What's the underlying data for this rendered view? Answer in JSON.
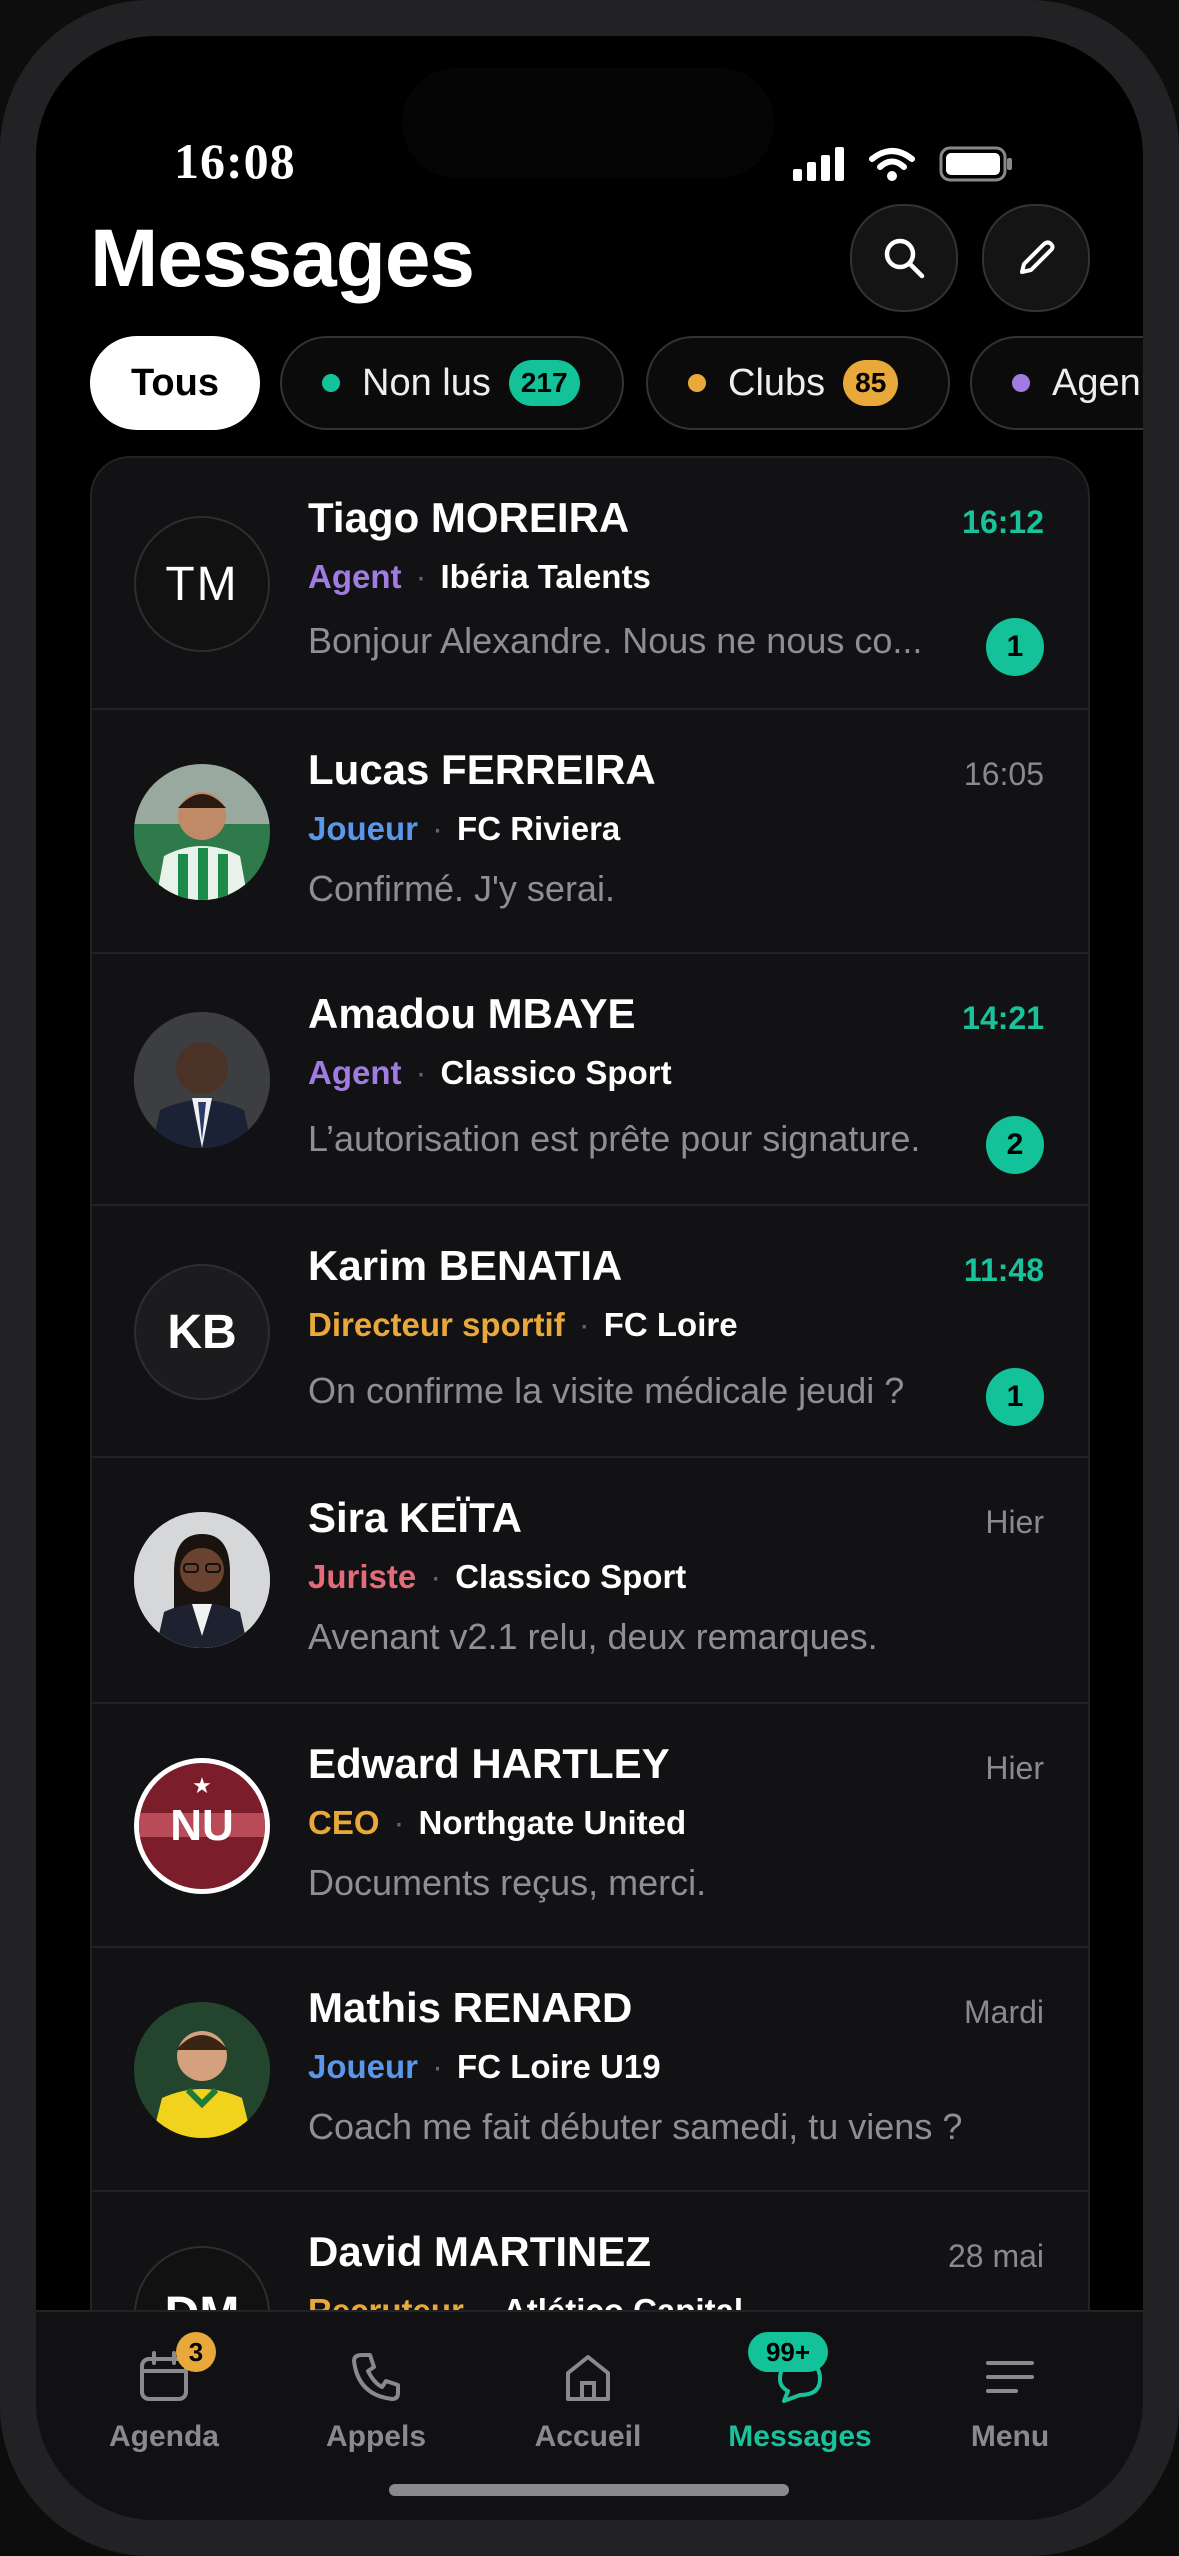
{
  "status": {
    "time": "16:08"
  },
  "header": {
    "title": "Messages"
  },
  "filters": [
    {
      "label": "Tous",
      "active": true
    },
    {
      "label": "Non lus",
      "count": "217",
      "color": "#14c29a"
    },
    {
      "label": "Clubs",
      "count": "85",
      "color": "#e8a93a"
    },
    {
      "label": "Agen",
      "color": "#a07be0"
    }
  ],
  "conversations": [
    {
      "name": "Tiago MOREIRA",
      "initials": "TM",
      "role": "Agent",
      "role_color": "#a07be0",
      "org": "Ibéria Talents",
      "preview": "Bonjour Alexandre. Nous ne nous co...",
      "time": "16:12",
      "unread": "1"
    },
    {
      "name": "Lucas FERREIRA",
      "avatar": "photo-green-jersey",
      "role": "Joueur",
      "role_color": "#5a97ea",
      "org": "FC Riviera",
      "preview": "Confirmé. J'y serai.",
      "time": "16:05"
    },
    {
      "name": "Amadou MBAYE",
      "avatar": "photo-suit",
      "role": "Agent",
      "role_color": "#a07be0",
      "org": "Classico Sport",
      "preview": "L’autorisation est prête pour signature.",
      "time": "14:21",
      "unread": "2"
    },
    {
      "name": "Karim BENATIA",
      "initials": "KB",
      "role": "Directeur sportif",
      "role_color": "#e8a93a",
      "org": "FC Loire",
      "preview": "On confirme la visite médicale jeudi ?",
      "time": "11:48",
      "unread": "1"
    },
    {
      "name": "Sira KEÏTA",
      "avatar": "photo-woman",
      "role": "Juriste",
      "role_color": "#e56b7a",
      "org": "Classico Sport",
      "preview": "Avenant v2.1 relu, deux remarques.",
      "time": "Hier"
    },
    {
      "name": "Edward HARTLEY",
      "initials": "NU",
      "avatar": "club-crest",
      "role": "CEO",
      "role_color": "#e8a93a",
      "org": "Northgate United",
      "preview": "Documents reçus, merci.",
      "time": "Hier"
    },
    {
      "name": "Mathis RENARD",
      "avatar": "photo-yellow-jersey",
      "role": "Joueur",
      "role_color": "#5a97ea",
      "org": "FC Loire U19",
      "preview": "Coach me fait débuter samedi, tu viens ?",
      "time": "Mardi"
    },
    {
      "name": "David MARTINEZ",
      "initials": "DM",
      "role": "Recruteur",
      "role_color": "#e8a93a",
      "org": "Atlético Capital",
      "preview": "",
      "time": "28 mai"
    }
  ],
  "tabbar": [
    {
      "label": "Agenda",
      "icon": "calendar-icon",
      "badge": "3"
    },
    {
      "label": "Appels",
      "icon": "phone-icon"
    },
    {
      "label": "Accueil",
      "icon": "home-icon"
    },
    {
      "label": "Messages",
      "icon": "chat-icon",
      "badge": "99+",
      "active": true
    },
    {
      "label": "Menu",
      "icon": "menu-icon"
    }
  ]
}
